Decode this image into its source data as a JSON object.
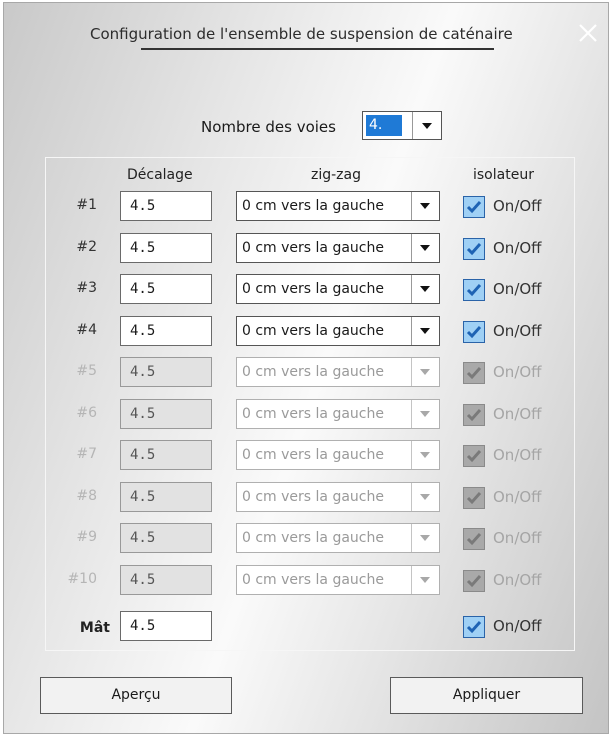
{
  "dialog": {
    "title": "Configuration de l'ensemble de suspension de caténaire",
    "close_icon": "close-icon"
  },
  "voies": {
    "label": "Nombre des voies",
    "value": "4."
  },
  "headers": {
    "decalage": "Décalage",
    "zigzag": "zig-zag",
    "isolateur": "isolateur"
  },
  "rows": [
    {
      "label": "#1",
      "decalage": "4.5",
      "zigzag": "0 cm vers la gauche",
      "onoff": "On/Off",
      "checked": true,
      "enabled": true
    },
    {
      "label": "#2",
      "decalage": "4.5",
      "zigzag": "0 cm vers la gauche",
      "onoff": "On/Off",
      "checked": true,
      "enabled": true
    },
    {
      "label": "#3",
      "decalage": "4.5",
      "zigzag": "0 cm vers la gauche",
      "onoff": "On/Off",
      "checked": true,
      "enabled": true
    },
    {
      "label": "#4",
      "decalage": "4.5",
      "zigzag": "0 cm vers la gauche",
      "onoff": "On/Off",
      "checked": true,
      "enabled": true
    },
    {
      "label": "#5",
      "decalage": "4.5",
      "zigzag": "0 cm vers la gauche",
      "onoff": "On/Off",
      "checked": true,
      "enabled": false
    },
    {
      "label": "#6",
      "decalage": "4.5",
      "zigzag": "0 cm vers la gauche",
      "onoff": "On/Off",
      "checked": true,
      "enabled": false
    },
    {
      "label": "#7",
      "decalage": "4.5",
      "zigzag": "0 cm vers la gauche",
      "onoff": "On/Off",
      "checked": true,
      "enabled": false
    },
    {
      "label": "#8",
      "decalage": "4.5",
      "zigzag": "0 cm vers la gauche",
      "onoff": "On/Off",
      "checked": true,
      "enabled": false
    },
    {
      "label": "#9",
      "decalage": "4.5",
      "zigzag": "0 cm vers la gauche",
      "onoff": "On/Off",
      "checked": true,
      "enabled": false
    },
    {
      "label": "#10",
      "decalage": "4.5",
      "zigzag": "0 cm vers la gauche",
      "onoff": "On/Off",
      "checked": true,
      "enabled": false
    }
  ],
  "mat": {
    "label": "Mât",
    "decalage": "4.5",
    "onoff": "On/Off",
    "checked": true
  },
  "buttons": {
    "apercu": "Aperçu",
    "appliquer": "Appliquer"
  },
  "colors": {
    "selection": "#1f7ad6",
    "checkbox_fill": "#9fd0f5",
    "checkmark": "#1e63b4"
  }
}
